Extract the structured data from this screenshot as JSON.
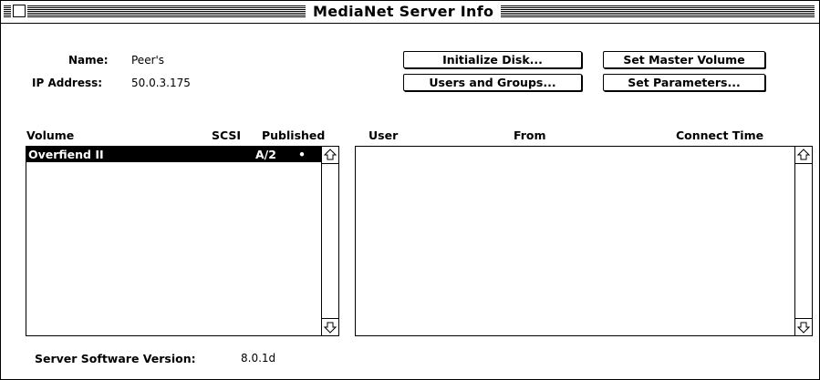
{
  "window": {
    "title": "MediaNet Server Info"
  },
  "info": {
    "name_label": "Name:",
    "name_value": "Peer's",
    "ip_label": "IP Address:",
    "ip_value": "50.0.3.175"
  },
  "buttons": {
    "initialize_disk": "Initialize Disk...",
    "users_and_groups": "Users and Groups...",
    "set_master_volume": "Set Master Volume",
    "set_parameters": "Set Parameters..."
  },
  "volumes": {
    "headers": {
      "volume": "Volume",
      "scsi": "SCSI",
      "published": "Published"
    },
    "rows": [
      {
        "volume": "Overfiend II",
        "scsi": "A/2",
        "published": "•",
        "selected": true
      }
    ]
  },
  "connections": {
    "headers": {
      "user": "User",
      "from": "From",
      "connect_time": "Connect Time"
    },
    "rows": []
  },
  "footer": {
    "version_label": "Server Software Version:",
    "version_value": "8.0.1d"
  },
  "icons": {
    "close_box": "close-box-icon",
    "scroll_up": "scroll-up-arrow-icon",
    "scroll_down": "scroll-down-arrow-icon"
  }
}
